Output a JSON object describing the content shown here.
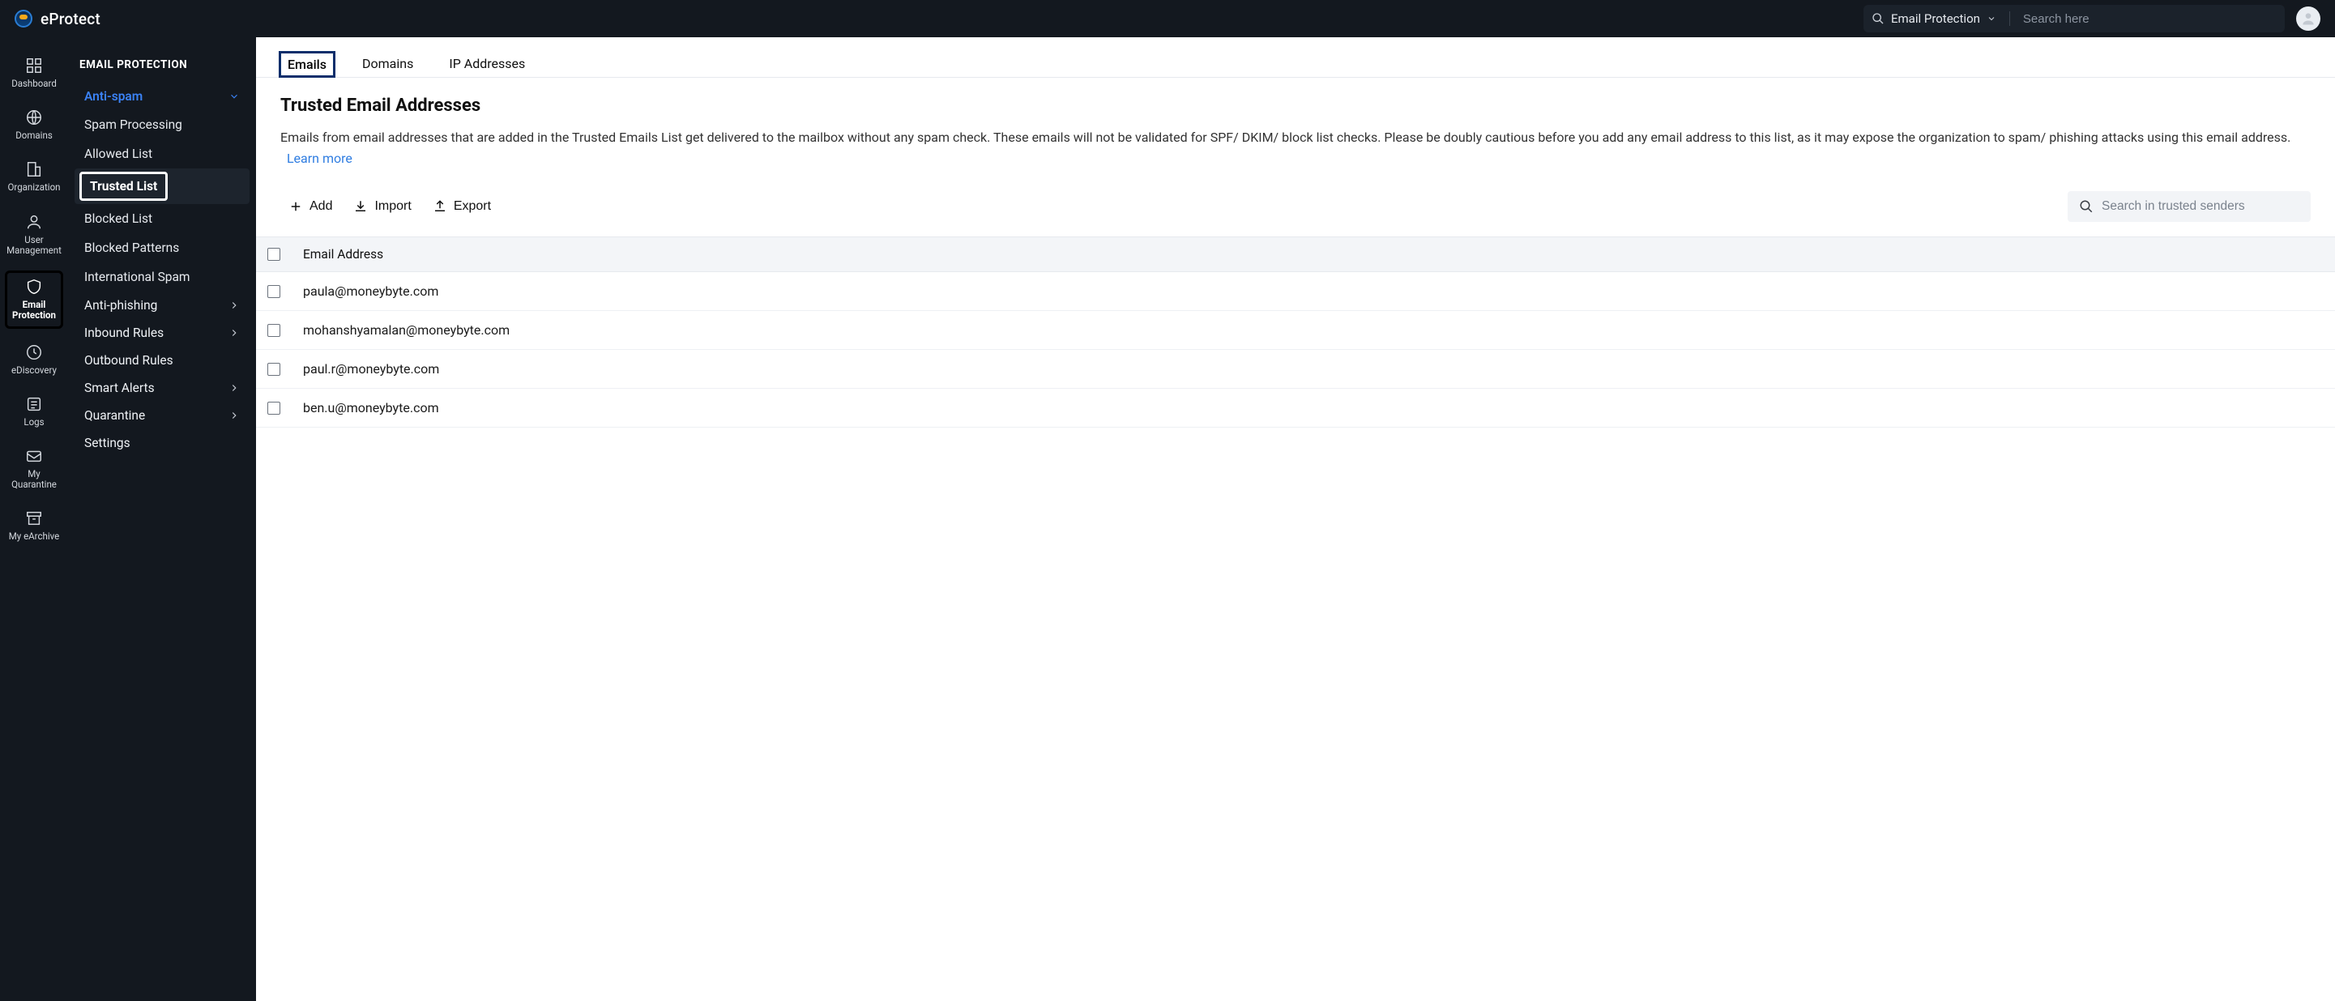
{
  "brand": {
    "name": "eProtect"
  },
  "topbar": {
    "scope_label": "Email Protection",
    "search_placeholder": "Search here"
  },
  "rail": {
    "items": [
      {
        "id": "dashboard",
        "label": "Dashboard"
      },
      {
        "id": "domains",
        "label": "Domains"
      },
      {
        "id": "organization",
        "label": "Organization"
      },
      {
        "id": "user-mgmt",
        "label": "User\nManagement"
      },
      {
        "id": "email-protection",
        "label": "Email\nProtection"
      },
      {
        "id": "ediscovery",
        "label": "eDiscovery"
      },
      {
        "id": "logs",
        "label": "Logs"
      },
      {
        "id": "my-quarantine",
        "label": "My\nQuarantine"
      },
      {
        "id": "my-earchive",
        "label": "My eArchive"
      }
    ]
  },
  "subsidebar": {
    "title": "EMAIL PROTECTION",
    "anti_spam": {
      "label": "Anti-spam",
      "children": [
        "Spam Processing",
        "Allowed List",
        "Trusted List",
        "Blocked List",
        "Blocked Patterns",
        "International Spam"
      ]
    },
    "others": [
      "Anti-phishing",
      "Inbound Rules",
      "Outbound Rules",
      "Smart Alerts",
      "Quarantine",
      "Settings"
    ],
    "others_expandable": [
      true,
      true,
      false,
      true,
      true,
      false
    ]
  },
  "tabs": [
    "Emails",
    "Domains",
    "IP Addresses"
  ],
  "page": {
    "title": "Trusted Email Addresses",
    "description": "Emails from email addresses that are added in the Trusted Emails List get delivered to the mailbox without any spam check. These emails will not be validated for SPF/ DKIM/ block list checks. Please be doubly cautious before you add any email address to this list, as it may expose the organization to spam/ phishing attacks using this email address.",
    "learn_more": "Learn more"
  },
  "toolbar": {
    "add": "Add",
    "import": "Import",
    "export": "Export",
    "search_placeholder": "Search in trusted senders"
  },
  "table": {
    "header": "Email Address",
    "rows": [
      "paula@moneybyte.com",
      "mohanshyamalan@moneybyte.com",
      "paul.r@moneybyte.com",
      "ben.u@moneybyte.com"
    ]
  }
}
